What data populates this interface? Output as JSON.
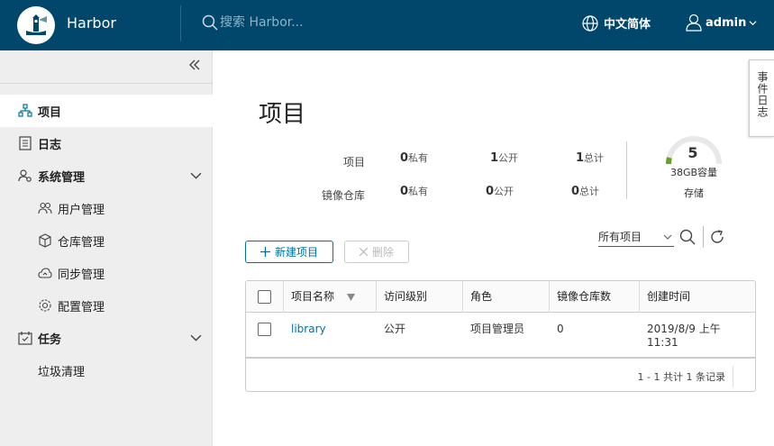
{
  "header": {
    "brand": "Harbor",
    "search_placeholder": "搜索 Harbor...",
    "language": "中文简体",
    "user": "admin"
  },
  "sidebar": {
    "items": [
      {
        "label": "项目",
        "icon": "project-icon",
        "active": true
      },
      {
        "label": "日志",
        "icon": "log-icon"
      },
      {
        "label": "系统管理",
        "icon": "admin-icon"
      },
      {
        "label": "用户管理",
        "icon": "users-icon"
      },
      {
        "label": "仓库管理",
        "icon": "registry-icon"
      },
      {
        "label": "同步管理",
        "icon": "replication-icon"
      },
      {
        "label": "配置管理",
        "icon": "config-icon"
      },
      {
        "label": "任务",
        "icon": "task-icon"
      },
      {
        "label": "垃圾清理"
      }
    ]
  },
  "page": {
    "title": "项目"
  },
  "stats": {
    "projects_label": "项目",
    "repos_label": "镜像仓库",
    "private_word": "私有",
    "public_word": "公开",
    "total_word": "总计",
    "projects": {
      "private": "0",
      "public": "1",
      "total": "1"
    },
    "repos": {
      "private": "0",
      "public": "0",
      "total": "0"
    },
    "storage": {
      "count": "5",
      "capacity": "38GB容量",
      "label": "存储",
      "used_fraction": 0.08
    }
  },
  "toolbar": {
    "new_project": "新建项目",
    "delete": "删除",
    "filter": "所有项目"
  },
  "table": {
    "headers": [
      "项目名称",
      "访问级别",
      "角色",
      "镜像仓库数",
      "创建时间"
    ],
    "rows": [
      {
        "name": "library",
        "access": "公开",
        "role": "项目管理员",
        "repo_count": "0",
        "created_line1": "2019/8/9 上午",
        "created_line2": "11:31"
      }
    ],
    "footer": "1 - 1 共计 1 条记录"
  },
  "event_tab": "事件日志",
  "colors": {
    "header_bg": "#00476b",
    "accent": "#0072a3",
    "gauge_used": "#62a420",
    "gauge_track": "#e8e8e8"
  }
}
